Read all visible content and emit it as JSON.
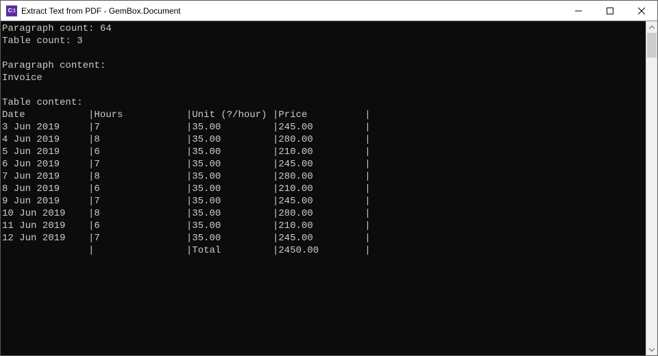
{
  "window": {
    "icon_text": "C:\\",
    "title": "Extract Text from PDF - GemBox.Document"
  },
  "console": {
    "para_count_label": "Paragraph count: ",
    "para_count_value": "64",
    "table_count_label": "Table count: ",
    "table_count_value": "3",
    "para_content_label": "Paragraph content:",
    "para_content_value": "Invoice",
    "table_content_label": "Table content:",
    "columns": [
      "Date",
      "Hours",
      "Unit (?/hour)",
      "Price"
    ],
    "rows": [
      {
        "date": "3 Jun 2019",
        "hours": "7",
        "unit": "35.00",
        "price": "245.00"
      },
      {
        "date": "4 Jun 2019",
        "hours": "8",
        "unit": "35.00",
        "price": "280.00"
      },
      {
        "date": "5 Jun 2019",
        "hours": "6",
        "unit": "35.00",
        "price": "210.00"
      },
      {
        "date": "6 Jun 2019",
        "hours": "7",
        "unit": "35.00",
        "price": "245.00"
      },
      {
        "date": "7 Jun 2019",
        "hours": "8",
        "unit": "35.00",
        "price": "280.00"
      },
      {
        "date": "8 Jun 2019",
        "hours": "6",
        "unit": "35.00",
        "price": "210.00"
      },
      {
        "date": "9 Jun 2019",
        "hours": "7",
        "unit": "35.00",
        "price": "245.00"
      },
      {
        "date": "10 Jun 2019",
        "hours": "8",
        "unit": "35.00",
        "price": "280.00"
      },
      {
        "date": "11 Jun 2019",
        "hours": "6",
        "unit": "35.00",
        "price": "210.00"
      },
      {
        "date": "12 Jun 2019",
        "hours": "7",
        "unit": "35.00",
        "price": "245.00"
      }
    ],
    "total_label": "Total",
    "total_value": "2450.00"
  },
  "col_widths": {
    "date": 15,
    "hours": 16,
    "unit": 14,
    "price": 15
  }
}
